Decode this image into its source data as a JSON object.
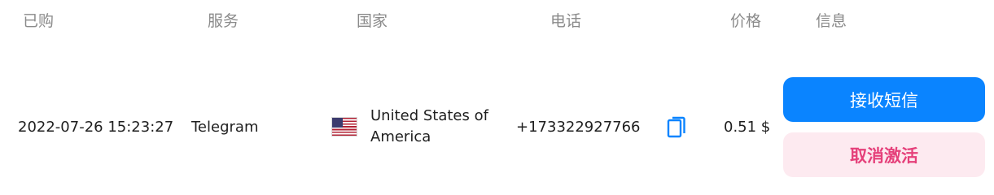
{
  "header": {
    "bought": "已购",
    "service": "服务",
    "country": "国家",
    "phone": "电话",
    "price": "价格",
    "info": "信息"
  },
  "row": {
    "date": "2022-07-26 15:23:27",
    "service": "Telegram",
    "country": "United States of America",
    "flag_icon": "us-flag-icon",
    "phone": "+173322927766",
    "copy_icon": "copy-icon",
    "price": "0.51 $",
    "receive_sms_label": "接收短信",
    "cancel_activation_label": "取消激活"
  },
  "colors": {
    "accent_blue": "#0a84ff",
    "cancel_bg": "#fdeaf0",
    "cancel_text": "#e5407a",
    "header_text": "#8a8a8a"
  }
}
